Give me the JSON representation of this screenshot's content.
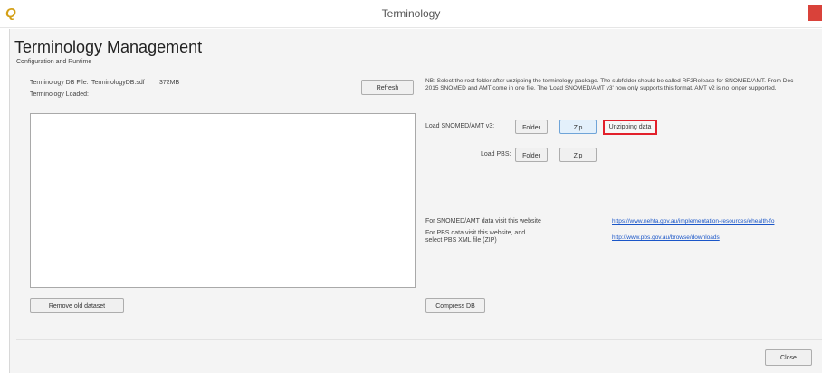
{
  "window": {
    "title": "Terminology"
  },
  "page": {
    "heading": "Terminology Management",
    "section_label": "Configuration and Runtime"
  },
  "db": {
    "file_label": "Terminology DB File:",
    "file_name": "TerminologyDB.sdf",
    "file_size": "372MB",
    "loaded_label": "Terminology Loaded:"
  },
  "buttons": {
    "refresh": "Refresh",
    "remove_old": "Remove old dataset",
    "compress": "Compress DB",
    "close": "Close",
    "folder": "Folder",
    "zip": "Zip"
  },
  "note": "NB: Select the root folder after unzipping the terminology package. The subfolder should be called RF2Release for SNOMED/AMT. From Dec 2015 SNOMED and AMT come in one file. The 'Load SNOMED/AMT v3' now only supports this format. AMT v2 is no longer supported.",
  "loaders": {
    "snomed_label": "Load SNOMED/AMT v3:",
    "pbs_label": "Load PBS:",
    "status": "Unzipping data"
  },
  "links": {
    "snomed_text": "For SNOMED/AMT data visit this website",
    "snomed_url": "https://www.nehta.gov.au/implementation-resources/ehealth-fo",
    "pbs_text": "For PBS data visit this website, and select PBS XML file (ZIP)",
    "pbs_url": "http://www.pbs.gov.au/browse/downloads"
  }
}
